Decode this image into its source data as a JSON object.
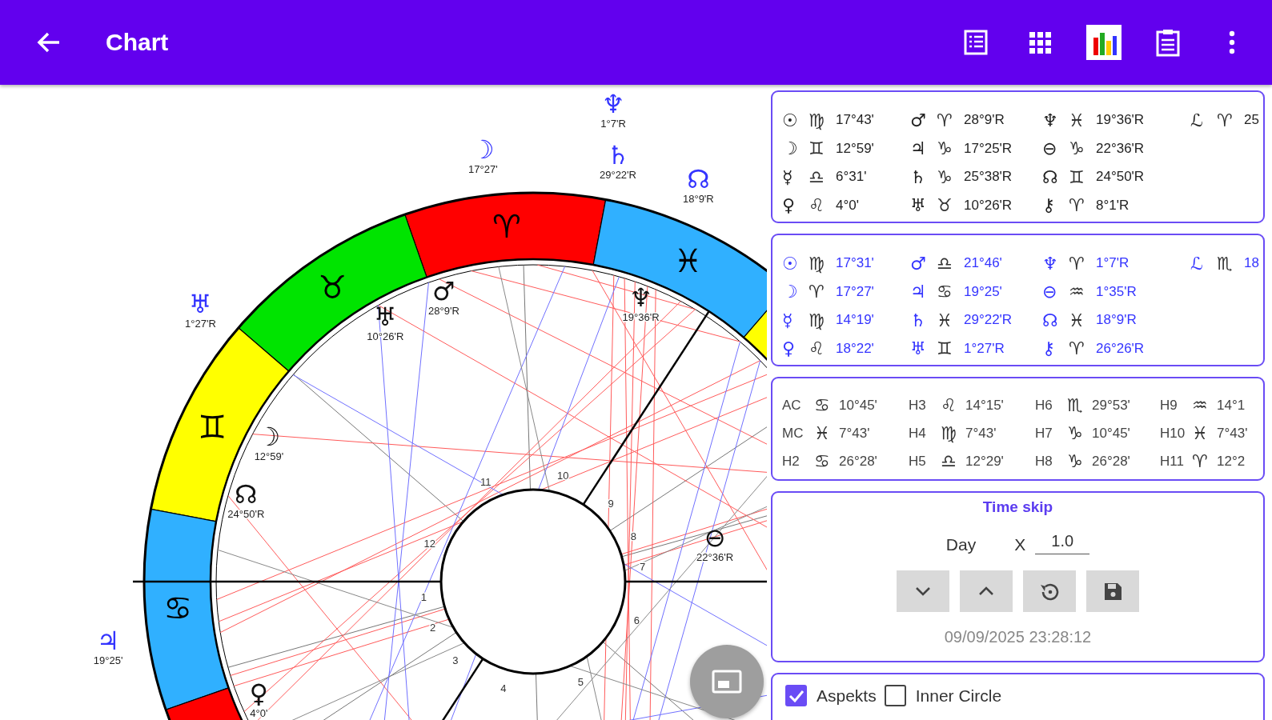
{
  "app_bar": {
    "title": "Chart",
    "actions": [
      {
        "kind": "list",
        "selected": false
      },
      {
        "kind": "grid",
        "selected": false
      },
      {
        "kind": "chart",
        "selected": true
      },
      {
        "kind": "clipboard",
        "selected": false
      },
      {
        "kind": "more",
        "selected": false
      }
    ]
  },
  "chart": {
    "signs": [
      {
        "kind": "aries",
        "glyph": "♈",
        "transit": [
          {
            "glyph": "♆",
            "label": "1°7'R"
          },
          {
            "glyph": "☽",
            "label": "17°27'"
          }
        ],
        "natal": [
          {
            "glyph": "♂",
            "label": "28°9'R"
          }
        ]
      },
      {
        "kind": "taurus",
        "glyph": "♉",
        "natal": [
          {
            "glyph": "♅",
            "label": "10°26'R"
          }
        ]
      },
      {
        "kind": "gemini",
        "glyph": "♊",
        "transit": [
          {
            "glyph": "♅",
            "label": "1°27'R"
          }
        ],
        "natal": [
          {
            "glyph": "☽",
            "label": "12°59'"
          },
          {
            "glyph": "☊",
            "label": "24°50'R"
          }
        ]
      },
      {
        "kind": "cancer",
        "glyph": "♋",
        "transit": [
          {
            "glyph": "♃",
            "label": "19°25'"
          }
        ]
      },
      {
        "kind": "leo",
        "natal": [
          {
            "glyph": "♀",
            "label": "4°0'"
          }
        ]
      },
      {
        "kind": "capricorn",
        "natal_inner": [
          {
            "glyph": "⊖",
            "label": "22°36'R"
          }
        ]
      },
      {
        "kind": "pisces",
        "glyph": "♓",
        "transit": [
          {
            "glyph": "♄",
            "label": "29°22'R"
          },
          {
            "glyph": "☊",
            "label": "18°9'R"
          }
        ],
        "natal": [
          {
            "glyph": "♆",
            "label": "19°36'R"
          }
        ]
      }
    ],
    "house_numbers": [
      "1",
      "2",
      "3",
      "4",
      "5",
      "6",
      "7",
      "8",
      "9",
      "10",
      "11",
      "12"
    ]
  },
  "position_tables": [
    {
      "color": "#222222",
      "columns": [
        [
          {
            "body": "☉",
            "sign": "♍",
            "value": "17°43'"
          },
          {
            "body": "☽",
            "sign": "♊",
            "value": "12°59'"
          },
          {
            "body": "☿",
            "sign": "♎",
            "value": "6°31'"
          },
          {
            "body": "♀",
            "sign": "♌",
            "value": "4°0'"
          }
        ],
        [
          {
            "body": "♂",
            "sign": "♈",
            "value": "28°9'R"
          },
          {
            "body": "♃",
            "sign": "♑",
            "value": "17°25'R"
          },
          {
            "body": "♄",
            "sign": "♑",
            "value": "25°38'R"
          },
          {
            "body": "♅",
            "sign": "♉",
            "value": "10°26'R"
          }
        ],
        [
          {
            "body": "♆",
            "sign": "♓",
            "value": "19°36'R"
          },
          {
            "body": "⊖",
            "sign": "♑",
            "value": "22°36'R"
          },
          {
            "body": "☊",
            "sign": "♊",
            "value": "24°50'R"
          },
          {
            "body": "⚷",
            "sign": "♈",
            "value": "8°1'R"
          }
        ],
        [
          {
            "body": "ℒ",
            "sign": "♈",
            "value": "25"
          }
        ]
      ]
    },
    {
      "color": "#3434ff",
      "columns": [
        [
          {
            "body": "☉",
            "sign": "♍",
            "value": "17°31'"
          },
          {
            "body": "☽",
            "sign": "♈",
            "value": "17°27'"
          },
          {
            "body": "☿",
            "sign": "♍",
            "value": "14°19'"
          },
          {
            "body": "♀",
            "sign": "♌",
            "value": "18°22'"
          }
        ],
        [
          {
            "body": "♂",
            "sign": "♎",
            "value": "21°46'"
          },
          {
            "body": "♃",
            "sign": "♋",
            "value": "19°25'"
          },
          {
            "body": "♄",
            "sign": "♓",
            "value": "29°22'R"
          },
          {
            "body": "♅",
            "sign": "♊",
            "value": "1°27'R"
          }
        ],
        [
          {
            "body": "♆",
            "sign": "♈",
            "value": "1°7'R"
          },
          {
            "body": "⊖",
            "sign": "♒",
            "value": "1°35'R"
          },
          {
            "body": "☊",
            "sign": "♓",
            "value": "18°9'R"
          },
          {
            "body": "⚷",
            "sign": "♈",
            "value": "26°26'R"
          }
        ],
        [
          {
            "body": "ℒ",
            "sign": "♏",
            "value": "18"
          }
        ]
      ]
    }
  ],
  "houses": {
    "columns": [
      [
        {
          "label": "AC",
          "sign": "♋",
          "value": "10°45'"
        },
        {
          "label": "MC",
          "sign": "♓",
          "value": "7°43'"
        },
        {
          "label": "H2",
          "sign": "♋",
          "value": "26°28'"
        }
      ],
      [
        {
          "label": "H3",
          "sign": "♌",
          "value": "14°15'"
        },
        {
          "label": "H4",
          "sign": "♍",
          "value": "7°43'"
        },
        {
          "label": "H5",
          "sign": "♎",
          "value": "12°29'"
        }
      ],
      [
        {
          "label": "H6",
          "sign": "♏",
          "value": "29°53'"
        },
        {
          "label": "H7",
          "sign": "♑",
          "value": "10°45'"
        },
        {
          "label": "H8",
          "sign": "♑",
          "value": "26°28'"
        }
      ],
      [
        {
          "label": "H9",
          "sign": "♒",
          "value": "14°1"
        },
        {
          "label": "H10",
          "sign": "♓",
          "value": "7°43'"
        },
        {
          "label": "H11",
          "sign": "♈",
          "value": "12°2"
        }
      ]
    ]
  },
  "time_skip": {
    "title": "Time skip",
    "unit": "Day",
    "multiplier_label": "X",
    "multiplier": "1.0",
    "buttons": [
      {
        "kind": "down"
      },
      {
        "kind": "up"
      },
      {
        "kind": "reset"
      },
      {
        "kind": "save"
      }
    ],
    "timestamp": "09/09/2025 23:28:12"
  },
  "options": [
    {
      "label": "Aspekts",
      "checked": true
    },
    {
      "label": "Inner Circle",
      "checked": false
    }
  ]
}
